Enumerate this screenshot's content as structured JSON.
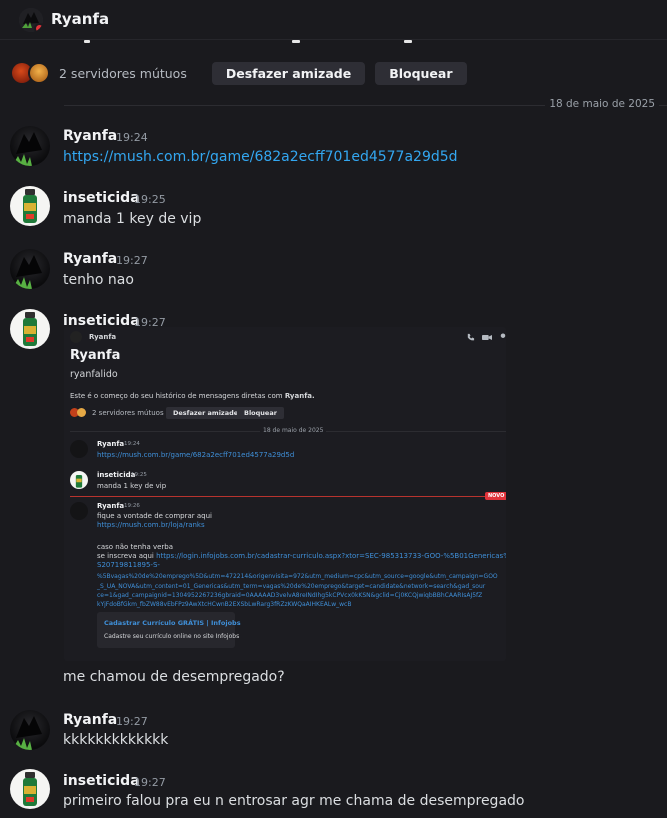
{
  "header": {
    "title": "Ryanfa"
  },
  "profile_bar": {
    "mutual_servers_text": "2 servidores mútuos",
    "unfriend_label": "Desfazer amizade",
    "block_label": "Bloquear"
  },
  "date_divider": "18 de maio de 2025",
  "messages": [
    {
      "author": "Ryanfa",
      "time": "19:24",
      "text": "https://mush.com.br/game/682a2ecff701ed4577a29d5d"
    },
    {
      "author": "inseticida",
      "time": "19:25",
      "text": "manda 1 key de vip"
    },
    {
      "author": "Ryanfa",
      "time": "19:27",
      "text": "tenho nao"
    },
    {
      "author": "inseticida",
      "time": "19:27",
      "text": ""
    },
    {
      "author": "",
      "time": "",
      "text": "me chamou de desempregado?"
    },
    {
      "author": "Ryanfa",
      "time": "19:27",
      "text": "kkkkkkkkkkkkk"
    },
    {
      "author": "inseticida",
      "time": "19:27",
      "text": "primeiro falou pra eu n entrosar agr me chama de desempregado"
    }
  ],
  "embedded_screenshot": {
    "header_title": "Ryanfa",
    "profile_name": "Ryanfa",
    "profile_username": "ryanfalido",
    "dm_start_text": "Este é o começo do seu histórico de mensagens diretas com",
    "dm_start_name": "Ryanfa.",
    "mutual_text": "2 servidores mútuos",
    "unfriend_label": "Desfazer amizade",
    "block_label": "Bloquear",
    "date": "18 de maio de 2025",
    "new_badge": "NOVO",
    "m1_author": "Ryanfa",
    "m1_time": "19:24",
    "m1_text": "https://mush.com.br/game/682a2ecff701ed4577a29d5d",
    "m2_author": "inseticida",
    "m2_time": "19:25",
    "m2_text": "manda 1 key de vip",
    "m3_author": "Ryanfa",
    "m3_time": "19:26",
    "m3_line1": "fique a vontade de comprar aqui",
    "m3_line2": "https://mush.com.br/loja/ranks",
    "m3_line3": "caso não tenha verba",
    "m3_line4_prefix": "se inscreva aqui",
    "m3_url1": "https://login.infojobs.com.br/cadastrar-curriculo.aspx?xtor=SEC-985313733-GOO-%5B01Genericas%5D-",
    "m3_url2": "S20719811895-S-",
    "m3_url3": "%5Bvagas%20de%20emprego%5D&utm=472214&origenvisita=972&utm_medium=cpc&utm_source=google&utm_campaign=GOO",
    "m3_url4": "_S_UA_NOVA&utm_content=01_Genericas&utm_term=vagas%20de%20emprego&target=candidate&network=search&gad_sour",
    "m3_url5": "ce=1&gad_campaignid=1304952267236gbraid=0AAAAAD3velvA8reINdIhg5kCPVcx0kKSN&gclid=Cj0KCQjwiqbBBhCAARIsAJ5fZ",
    "m3_url6": "kYjFdoBfGkm_fbZW88vEbFPz9AwXtcHCwnB2EXSbLwRarg3fRZzKWQaAIHKEALw_wcB",
    "card_title": "Cadastrar Currículo GRÁTIS | Infojobs",
    "card_desc": "Cadastre seu currículo online no site Infojobs"
  },
  "colors": {
    "link": "#33a7f1",
    "background": "#1a1a1e",
    "new_badge": "#e0333a"
  }
}
